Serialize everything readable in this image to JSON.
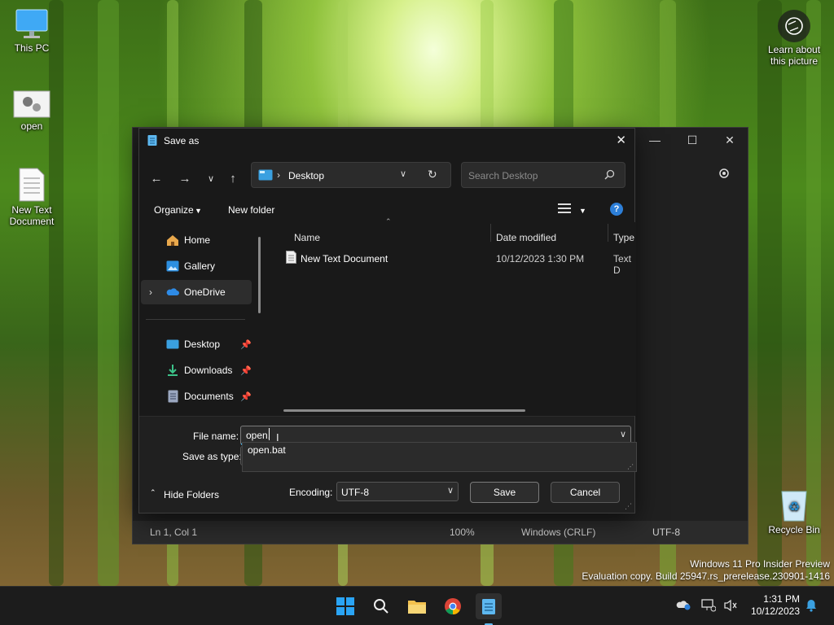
{
  "desktop": {
    "icons": [
      {
        "label": "This PC"
      },
      {
        "label": "open"
      },
      {
        "label": "New Text Document"
      },
      {
        "label": "Recycle Bin"
      }
    ],
    "learn_label": "Learn about this picture",
    "watermark": {
      "line1": "Windows 11 Pro Insider Preview",
      "line2": "Evaluation copy. Build 25947.rs_prerelease.230901-1416"
    }
  },
  "editor": {
    "status": {
      "position": "Ln 1, Col 1",
      "zoom": "100%",
      "line_ending": "Windows (CRLF)",
      "encoding": "UTF-8"
    }
  },
  "dialog": {
    "title": "Save as",
    "address": {
      "location": "Desktop"
    },
    "search_placeholder": "Search Desktop",
    "commands": {
      "organize": "Organize",
      "new_folder": "New folder"
    },
    "nav": [
      {
        "label": "Home"
      },
      {
        "label": "Gallery"
      },
      {
        "label": "OneDrive"
      },
      {
        "label": "Desktop"
      },
      {
        "label": "Downloads"
      },
      {
        "label": "Documents"
      }
    ],
    "columns": {
      "name": "Name",
      "date": "Date modified",
      "type": "Type"
    },
    "files": [
      {
        "name": "New Text Document",
        "date": "10/12/2023 1:30 PM",
        "type": "Text D"
      }
    ],
    "file_name_label": "File name:",
    "file_name_value": "open.",
    "save_as_type_label": "Save as type:",
    "autocomplete": [
      "open.bat"
    ],
    "hide_folders": "Hide Folders",
    "encoding_label": "Encoding:",
    "encoding_value": "UTF-8",
    "save": "Save",
    "cancel": "Cancel"
  },
  "taskbar": {
    "time": "1:31 PM",
    "date": "10/12/2023"
  }
}
